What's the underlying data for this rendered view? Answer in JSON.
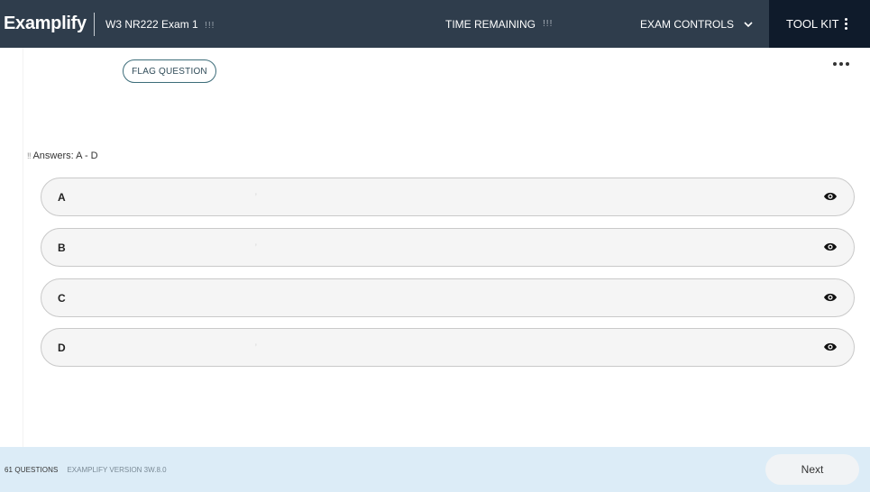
{
  "header": {
    "logo": "Examplify",
    "exam_title": "W3 NR222 Exam 1",
    "exam_title_suffix": "!!!",
    "time_label": "TIME REMAINING",
    "time_value": "!!!",
    "controls_label": "EXAM CONTROLS",
    "toolkit_label": "TOOL KIT",
    "colors": {
      "bar": "#2f3d4c",
      "toolkit_bg": "#0f1b2b"
    }
  },
  "question": {
    "flag_label": "FLAG QUESTION",
    "answers_prefix": "!!",
    "answers_label": "Answers: A - D"
  },
  "options": [
    {
      "letter": "A",
      "text": "’"
    },
    {
      "letter": "B",
      "text": "’"
    },
    {
      "letter": "C",
      "text": ""
    },
    {
      "letter": "D",
      "text": "’"
    }
  ],
  "icons": {
    "chevron": "chevron-down-icon",
    "kebab": "kebab-icon",
    "eye": "eye-icon",
    "more": "more-horizontal-icon"
  },
  "footer": {
    "count": "61 QUESTIONS",
    "version": "EXAMPLIFY VERSION 3W.8.0",
    "next_label": "Next",
    "colors": {
      "bg": "#dcecf7"
    }
  }
}
